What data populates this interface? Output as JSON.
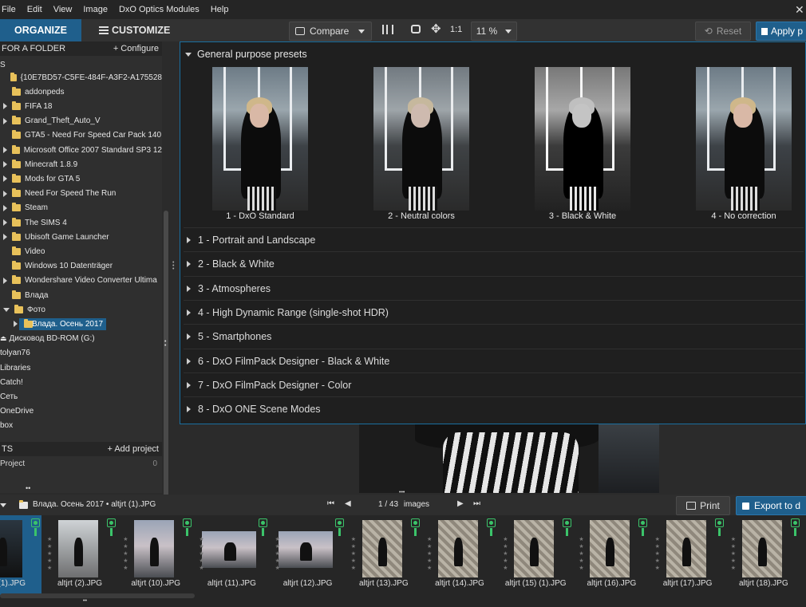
{
  "menu": [
    "File",
    "Edit",
    "View",
    "Image",
    "DxO Optics Modules",
    "Help"
  ],
  "toolbar": {
    "organize": "ORGANIZE",
    "customize": "CUSTOMIZE",
    "compare": "Compare",
    "one_to_one": "1:1",
    "zoom": "11 %",
    "reset": "Reset",
    "apply": "Apply p"
  },
  "folder_panel": {
    "header": "FOR A FOLDER",
    "configure": "+ Configure",
    "section_letter": "S",
    "items": [
      {
        "label": "{10E7BD57-C5FE-484F-A3F2-A175528",
        "indent": 1,
        "expand": "none",
        "icon": "folder"
      },
      {
        "label": "addonpeds",
        "indent": 1,
        "expand": "none",
        "icon": "folder"
      },
      {
        "label": "FIFA 18",
        "indent": 1,
        "expand": "right",
        "icon": "folder"
      },
      {
        "label": "Grand_Theft_Auto_V",
        "indent": 1,
        "expand": "right",
        "icon": "folder"
      },
      {
        "label": "GTA5 - Need For Speed Car Pack 140",
        "indent": 1,
        "expand": "none",
        "icon": "folder"
      },
      {
        "label": "Microsoft Office 2007 Standard SP3 12",
        "indent": 1,
        "expand": "right",
        "icon": "folder"
      },
      {
        "label": "Minecraft 1.8.9",
        "indent": 1,
        "expand": "right",
        "icon": "folder"
      },
      {
        "label": "Mods for GTA 5",
        "indent": 1,
        "expand": "right",
        "icon": "folder"
      },
      {
        "label": "Need For Speed The Run",
        "indent": 1,
        "expand": "right",
        "icon": "folder"
      },
      {
        "label": "Steam",
        "indent": 1,
        "expand": "right",
        "icon": "folder"
      },
      {
        "label": "The SIMS 4",
        "indent": 1,
        "expand": "right",
        "icon": "folder"
      },
      {
        "label": "Ubisoft Game Launcher",
        "indent": 1,
        "expand": "right",
        "icon": "folder"
      },
      {
        "label": "Video",
        "indent": 1,
        "expand": "none",
        "icon": "folder"
      },
      {
        "label": "Windows 10 Datenträger",
        "indent": 1,
        "expand": "none",
        "icon": "folder"
      },
      {
        "label": "Wondershare Video Converter Ultima",
        "indent": 1,
        "expand": "right",
        "icon": "folder"
      },
      {
        "label": "Влада",
        "indent": 1,
        "expand": "none",
        "icon": "folder"
      },
      {
        "label": "Фото",
        "indent": 1,
        "expand": "down",
        "icon": "folder"
      },
      {
        "label": "Влада. Осень 2017",
        "indent": 2,
        "expand": "right",
        "icon": "folder",
        "selected": true
      },
      {
        "label": "Дисковод BD-ROM (G:)",
        "indent": 0,
        "expand": "none",
        "icon": "disc"
      },
      {
        "label": "tolyan76",
        "indent": 0,
        "expand": "none",
        "icon": "none"
      },
      {
        "label": "Libraries",
        "indent": 0,
        "expand": "none",
        "icon": "none"
      },
      {
        "label": "Catch!",
        "indent": 0,
        "expand": "none",
        "icon": "none"
      },
      {
        "label": "Сеть",
        "indent": 0,
        "expand": "none",
        "icon": "none"
      },
      {
        "label": "OneDrive",
        "indent": 0,
        "expand": "none",
        "icon": "none"
      },
      {
        "label": "box",
        "indent": 0,
        "expand": "none",
        "icon": "none"
      }
    ]
  },
  "projects": {
    "header": "TS",
    "add": "+ Add project",
    "item": "Project",
    "count": "0"
  },
  "presets": {
    "header": "General purpose presets",
    "thumbs": [
      {
        "label": "1 - DxO Standard",
        "tone": "color"
      },
      {
        "label": "2 - Neutral colors",
        "tone": "neutral"
      },
      {
        "label": "3 - Black & White",
        "tone": "bw"
      },
      {
        "label": "4 - No correction",
        "tone": "color"
      }
    ],
    "categories": [
      "1 - Portrait and Landscape",
      "2 - Black & White",
      "3 - Atmospheres",
      "4 - High Dynamic Range (single-shot HDR)",
      "5 - Smartphones",
      "6 - DxO FilmPack Designer - Black & White",
      "7 - DxO FilmPack Designer - Color",
      "8 - DxO ONE Scene Modes"
    ]
  },
  "bottom_bar": {
    "path": "Влада. Осень 2017",
    "sep": "•",
    "file": "altjrt (1).JPG",
    "counter": "1 / 43",
    "images": "images",
    "print": "Print",
    "export": "Export to d"
  },
  "filmstrip": [
    {
      "label": "(1).JPG",
      "selected": true,
      "orient": "portrait",
      "tone": "dark"
    },
    {
      "label": "altjrt (2).JPG",
      "orient": "portrait",
      "tone": "mid"
    },
    {
      "label": "altjrt (10).JPG",
      "orient": "portrait",
      "tone": "sky"
    },
    {
      "label": "altjrt (11).JPG",
      "orient": "landscape",
      "tone": "sky"
    },
    {
      "label": "altjrt (12).JPG",
      "orient": "landscape",
      "tone": "sky"
    },
    {
      "label": "altjrt (13).JPG",
      "orient": "portrait",
      "tone": "wall"
    },
    {
      "label": "altjrt (14).JPG",
      "orient": "portrait",
      "tone": "wall"
    },
    {
      "label": "altjrt (15) (1).JPG",
      "orient": "portrait",
      "tone": "wall"
    },
    {
      "label": "altjrt (16).JPG",
      "orient": "portrait",
      "tone": "wall"
    },
    {
      "label": "altjrt (17).JPG",
      "orient": "portrait",
      "tone": "wall"
    },
    {
      "label": "altjrt (18).JPG",
      "orient": "portrait",
      "tone": "wall"
    }
  ]
}
